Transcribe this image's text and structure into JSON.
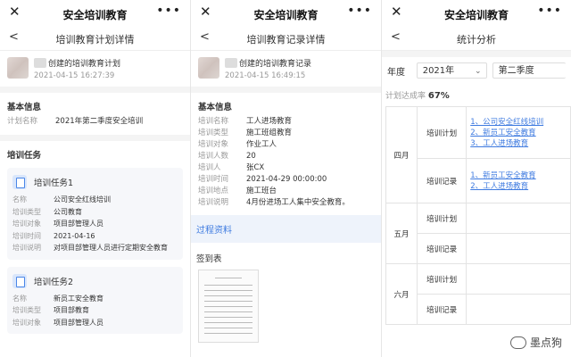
{
  "wechat": {
    "title": "安全培训教育",
    "close_icon": "✕",
    "more_icon": "•••"
  },
  "panel1": {
    "nav_title": "培训教育计划详情",
    "creator_title": "创建的培训教育计划",
    "creator_time": "2021-04-15 16:27:39",
    "basic_title": "基本信息",
    "plan_name_label": "计划名称",
    "plan_name_value": "2021年第二季度安全培训",
    "tasks_title": "培训任务",
    "tasks": [
      {
        "name": "培训任务1",
        "fields": [
          {
            "k": "名称",
            "v": "公司安全红线培训"
          },
          {
            "k": "培训类型",
            "v": "公司教育"
          },
          {
            "k": "培训对象",
            "v": "项目部管理人员"
          },
          {
            "k": "培训时间",
            "v": "2021-04-16"
          },
          {
            "k": "培训说明",
            "v": "对项目部管理人员进行定期安全教育"
          }
        ]
      },
      {
        "name": "培训任务2",
        "fields": [
          {
            "k": "名称",
            "v": "新员工安全教育"
          },
          {
            "k": "培训类型",
            "v": "项目部教育"
          },
          {
            "k": "培训对象",
            "v": "项目部管理人员"
          }
        ]
      }
    ]
  },
  "panel2": {
    "nav_title": "培训教育记录详情",
    "creator_title": "创建的培训教育记录",
    "creator_time": "2021-04-15 16:49:15",
    "basic_title": "基本信息",
    "fields": [
      {
        "k": "培训名称",
        "v": "工人进场教育"
      },
      {
        "k": "培训类型",
        "v": "施工班组教育"
      },
      {
        "k": "培训对象",
        "v": "作业工人"
      },
      {
        "k": "培训人数",
        "v": "20"
      },
      {
        "k": "培训人",
        "v": "张CX"
      },
      {
        "k": "培训时间",
        "v": "2021-04-29 00:00:00"
      },
      {
        "k": "培训地点",
        "v": "施工班台"
      },
      {
        "k": "培训说明",
        "v": "4月份进场工人集中安全教育。"
      }
    ],
    "process_link": "过程资料",
    "sign_title": "签到表"
  },
  "panel3": {
    "nav_title": "统计分析",
    "year_label": "年度",
    "year_value": "2021年",
    "quarter_value": "第二季度",
    "rate_label": "计划达成率",
    "rate_value": "67%",
    "months": [
      {
        "name": "四月",
        "plan_label": "培训计划",
        "plan_items": [
          "1、公司安全红线培训",
          "2、新员工安全教育",
          "3、工人进场教育"
        ],
        "record_label": "培训记录",
        "record_items": [
          "1、新员工安全教育",
          "2、工人进场教育"
        ]
      },
      {
        "name": "五月",
        "plan_label": "培训计划",
        "plan_items": [],
        "record_label": "培训记录",
        "record_items": []
      },
      {
        "name": "六月",
        "plan_label": "培训计划",
        "plan_items": [],
        "record_label": "培训记录",
        "record_items": []
      }
    ]
  },
  "watermark": "墨点狗"
}
